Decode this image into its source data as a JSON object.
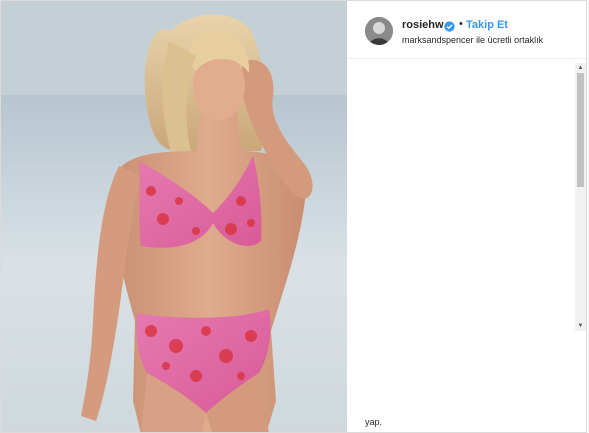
{
  "post": {
    "username": "rosiehw",
    "separator": "•",
    "follow_label": "Takip Et",
    "partner_brand": "marksandspencer",
    "partner_suffix": "ile ücretli ortaklık",
    "comment_fragment": "yap."
  },
  "icons": {
    "verified": "verified-badge-icon",
    "scroll_up": "chevron-up-icon",
    "scroll_down": "chevron-down-icon"
  },
  "colors": {
    "link_blue": "#3897f0",
    "verified_blue": "#3897f0",
    "text_dark": "#262626",
    "swimsuit_pink": "#e46aa6",
    "swimsuit_red": "#d92e3b"
  },
  "scroll": {
    "thumb_fraction": 0.43
  }
}
